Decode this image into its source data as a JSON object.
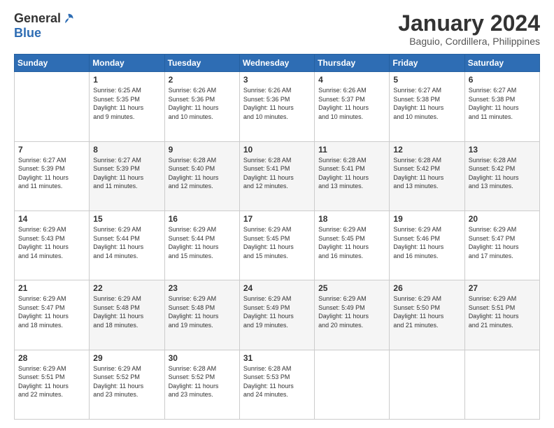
{
  "logo": {
    "general": "General",
    "blue": "Blue"
  },
  "title": "January 2024",
  "location": "Baguio, Cordillera, Philippines",
  "headers": [
    "Sunday",
    "Monday",
    "Tuesday",
    "Wednesday",
    "Thursday",
    "Friday",
    "Saturday"
  ],
  "weeks": [
    [
      {
        "day": "",
        "info": ""
      },
      {
        "day": "1",
        "info": "Sunrise: 6:25 AM\nSunset: 5:35 PM\nDaylight: 11 hours\nand 9 minutes."
      },
      {
        "day": "2",
        "info": "Sunrise: 6:26 AM\nSunset: 5:36 PM\nDaylight: 11 hours\nand 10 minutes."
      },
      {
        "day": "3",
        "info": "Sunrise: 6:26 AM\nSunset: 5:36 PM\nDaylight: 11 hours\nand 10 minutes."
      },
      {
        "day": "4",
        "info": "Sunrise: 6:26 AM\nSunset: 5:37 PM\nDaylight: 11 hours\nand 10 minutes."
      },
      {
        "day": "5",
        "info": "Sunrise: 6:27 AM\nSunset: 5:38 PM\nDaylight: 11 hours\nand 10 minutes."
      },
      {
        "day": "6",
        "info": "Sunrise: 6:27 AM\nSunset: 5:38 PM\nDaylight: 11 hours\nand 11 minutes."
      }
    ],
    [
      {
        "day": "7",
        "info": "Sunrise: 6:27 AM\nSunset: 5:39 PM\nDaylight: 11 hours\nand 11 minutes."
      },
      {
        "day": "8",
        "info": "Sunrise: 6:27 AM\nSunset: 5:39 PM\nDaylight: 11 hours\nand 11 minutes."
      },
      {
        "day": "9",
        "info": "Sunrise: 6:28 AM\nSunset: 5:40 PM\nDaylight: 11 hours\nand 12 minutes."
      },
      {
        "day": "10",
        "info": "Sunrise: 6:28 AM\nSunset: 5:41 PM\nDaylight: 11 hours\nand 12 minutes."
      },
      {
        "day": "11",
        "info": "Sunrise: 6:28 AM\nSunset: 5:41 PM\nDaylight: 11 hours\nand 13 minutes."
      },
      {
        "day": "12",
        "info": "Sunrise: 6:28 AM\nSunset: 5:42 PM\nDaylight: 11 hours\nand 13 minutes."
      },
      {
        "day": "13",
        "info": "Sunrise: 6:28 AM\nSunset: 5:42 PM\nDaylight: 11 hours\nand 13 minutes."
      }
    ],
    [
      {
        "day": "14",
        "info": "Sunrise: 6:29 AM\nSunset: 5:43 PM\nDaylight: 11 hours\nand 14 minutes."
      },
      {
        "day": "15",
        "info": "Sunrise: 6:29 AM\nSunset: 5:44 PM\nDaylight: 11 hours\nand 14 minutes."
      },
      {
        "day": "16",
        "info": "Sunrise: 6:29 AM\nSunset: 5:44 PM\nDaylight: 11 hours\nand 15 minutes."
      },
      {
        "day": "17",
        "info": "Sunrise: 6:29 AM\nSunset: 5:45 PM\nDaylight: 11 hours\nand 15 minutes."
      },
      {
        "day": "18",
        "info": "Sunrise: 6:29 AM\nSunset: 5:45 PM\nDaylight: 11 hours\nand 16 minutes."
      },
      {
        "day": "19",
        "info": "Sunrise: 6:29 AM\nSunset: 5:46 PM\nDaylight: 11 hours\nand 16 minutes."
      },
      {
        "day": "20",
        "info": "Sunrise: 6:29 AM\nSunset: 5:47 PM\nDaylight: 11 hours\nand 17 minutes."
      }
    ],
    [
      {
        "day": "21",
        "info": "Sunrise: 6:29 AM\nSunset: 5:47 PM\nDaylight: 11 hours\nand 18 minutes."
      },
      {
        "day": "22",
        "info": "Sunrise: 6:29 AM\nSunset: 5:48 PM\nDaylight: 11 hours\nand 18 minutes."
      },
      {
        "day": "23",
        "info": "Sunrise: 6:29 AM\nSunset: 5:48 PM\nDaylight: 11 hours\nand 19 minutes."
      },
      {
        "day": "24",
        "info": "Sunrise: 6:29 AM\nSunset: 5:49 PM\nDaylight: 11 hours\nand 19 minutes."
      },
      {
        "day": "25",
        "info": "Sunrise: 6:29 AM\nSunset: 5:49 PM\nDaylight: 11 hours\nand 20 minutes."
      },
      {
        "day": "26",
        "info": "Sunrise: 6:29 AM\nSunset: 5:50 PM\nDaylight: 11 hours\nand 21 minutes."
      },
      {
        "day": "27",
        "info": "Sunrise: 6:29 AM\nSunset: 5:51 PM\nDaylight: 11 hours\nand 21 minutes."
      }
    ],
    [
      {
        "day": "28",
        "info": "Sunrise: 6:29 AM\nSunset: 5:51 PM\nDaylight: 11 hours\nand 22 minutes."
      },
      {
        "day": "29",
        "info": "Sunrise: 6:29 AM\nSunset: 5:52 PM\nDaylight: 11 hours\nand 23 minutes."
      },
      {
        "day": "30",
        "info": "Sunrise: 6:28 AM\nSunset: 5:52 PM\nDaylight: 11 hours\nand 23 minutes."
      },
      {
        "day": "31",
        "info": "Sunrise: 6:28 AM\nSunset: 5:53 PM\nDaylight: 11 hours\nand 24 minutes."
      },
      {
        "day": "",
        "info": ""
      },
      {
        "day": "",
        "info": ""
      },
      {
        "day": "",
        "info": ""
      }
    ]
  ]
}
